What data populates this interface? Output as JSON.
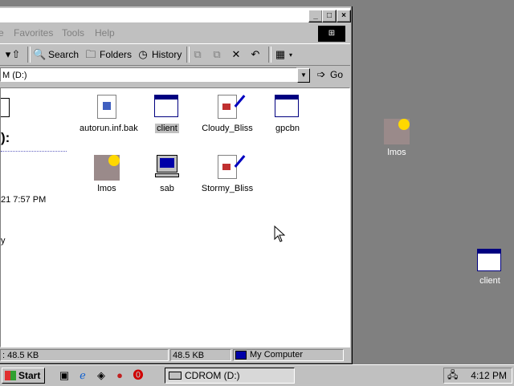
{
  "window": {
    "menu": [
      "Favorites",
      "Tools",
      "Help"
    ],
    "menu_prefix": "e",
    "controls": {
      "minimize": "_",
      "maximize": "□",
      "close": "×"
    }
  },
  "toolbar": {
    "search_label": "Search",
    "folders_label": "Folders",
    "history_label": "History"
  },
  "address": {
    "value": "M (D:)",
    "go_label": "Go"
  },
  "left_pane": {
    "heading": "):",
    "date": "21 7:57 PM",
    "other": "y"
  },
  "files": [
    {
      "name": "autorun.inf.bak",
      "icon": "settings-file-icon",
      "selected": false
    },
    {
      "name": "client",
      "icon": "application-window-icon",
      "selected": true
    },
    {
      "name": "Cloudy_Bliss",
      "icon": "paint-document-icon",
      "selected": false
    },
    {
      "name": "gpcbn",
      "icon": "application-window-icon",
      "selected": false
    },
    {
      "name": "lmos",
      "icon": "image-icon",
      "selected": false
    },
    {
      "name": "sab",
      "icon": "computer-icon",
      "selected": false
    },
    {
      "name": "Stormy_Bliss",
      "icon": "paint-document-icon",
      "selected": false
    }
  ],
  "status": {
    "left": ": 48.5 KB",
    "size": "48.5 KB",
    "zone": "My Computer"
  },
  "desktop": {
    "icons": [
      {
        "name": "lmos",
        "icon": "image-icon"
      },
      {
        "name": "client",
        "icon": "application-window-icon"
      }
    ]
  },
  "taskbar": {
    "start_label": "Start",
    "task_label": "CDROM (D:)",
    "clock": "4:12 PM"
  }
}
